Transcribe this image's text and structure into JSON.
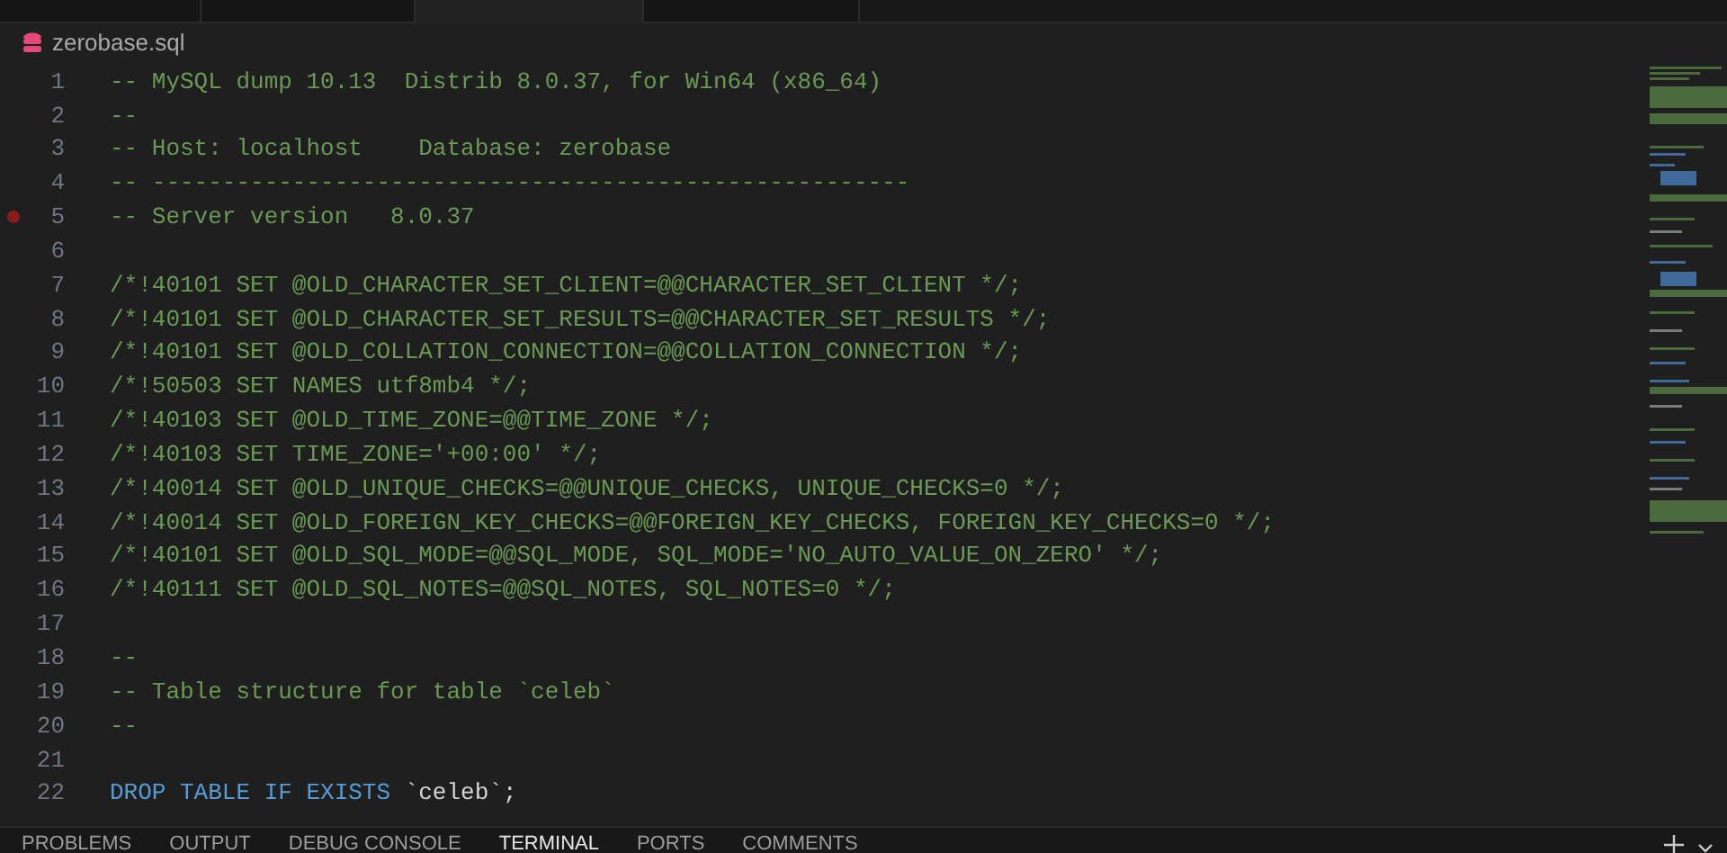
{
  "editor_tabs": [
    {
      "selected": false
    },
    {
      "selected": false
    },
    {
      "selected": true
    },
    {
      "selected": false
    }
  ],
  "breadcrumb": "zerobase.sql",
  "lines": [
    {
      "number": "1",
      "segments": [
        {
          "kind": "comment",
          "text": "-- MySQL dump 10.13  Distrib 8.0.37, for Win64 (x86_64)"
        }
      ]
    },
    {
      "number": "2",
      "segments": [
        {
          "kind": "comment",
          "text": "--"
        }
      ]
    },
    {
      "number": "3",
      "segments": [
        {
          "kind": "comment",
          "text": "-- Host: localhost    Database: zerobase"
        }
      ]
    },
    {
      "number": "4",
      "segments": [
        {
          "kind": "comment",
          "text": "-- ------------------------------------------------------"
        }
      ]
    },
    {
      "number": "5",
      "breakpoint": true,
      "segments": [
        {
          "kind": "comment",
          "text": "-- Server version\t8.0.37"
        }
      ]
    },
    {
      "number": "6"
    },
    {
      "number": "7",
      "segments": [
        {
          "kind": "comment",
          "text": "/*!40101 SET @OLD_CHARACTER_SET_CLIENT=@@CHARACTER_SET_CLIENT */;"
        }
      ]
    },
    {
      "number": "8",
      "segments": [
        {
          "kind": "comment",
          "text": "/*!40101 SET @OLD_CHARACTER_SET_RESULTS=@@CHARACTER_SET_RESULTS */;"
        }
      ]
    },
    {
      "number": "9",
      "segments": [
        {
          "kind": "comment",
          "text": "/*!40101 SET @OLD_COLLATION_CONNECTION=@@COLLATION_CONNECTION */;"
        }
      ]
    },
    {
      "number": "10",
      "segments": [
        {
          "kind": "comment",
          "text": "/*!50503 SET NAMES utf8mb4 */;"
        }
      ]
    },
    {
      "number": "11",
      "segments": [
        {
          "kind": "comment",
          "text": "/*!40103 SET @OLD_TIME_ZONE=@@TIME_ZONE */;"
        }
      ]
    },
    {
      "number": "12",
      "segments": [
        {
          "kind": "comment",
          "text": "/*!40103 SET TIME_ZONE='+00:00' */;"
        }
      ]
    },
    {
      "number": "13",
      "segments": [
        {
          "kind": "comment",
          "text": "/*!40014 SET @OLD_UNIQUE_CHECKS=@@UNIQUE_CHECKS, UNIQUE_CHECKS=0 */;"
        }
      ]
    },
    {
      "number": "14",
      "segments": [
        {
          "kind": "comment",
          "text": "/*!40014 SET @OLD_FOREIGN_KEY_CHECKS=@@FOREIGN_KEY_CHECKS, FOREIGN_KEY_CHECKS=0 */;"
        }
      ]
    },
    {
      "number": "15",
      "segments": [
        {
          "kind": "comment",
          "text": "/*!40101 SET @OLD_SQL_MODE=@@SQL_MODE, SQL_MODE='NO_AUTO_VALUE_ON_ZERO' */;"
        }
      ]
    },
    {
      "number": "16",
      "segments": [
        {
          "kind": "comment",
          "text": "/*!40111 SET @OLD_SQL_NOTES=@@SQL_NOTES, SQL_NOTES=0 */;"
        }
      ]
    },
    {
      "number": "17"
    },
    {
      "number": "18",
      "segments": [
        {
          "kind": "comment",
          "text": "--"
        }
      ]
    },
    {
      "number": "19",
      "segments": [
        {
          "kind": "comment",
          "text": "-- Table structure for table `celeb`"
        }
      ]
    },
    {
      "number": "20",
      "segments": [
        {
          "kind": "comment",
          "text": "--"
        }
      ]
    },
    {
      "number": "21"
    },
    {
      "number": "22",
      "segments": [
        {
          "kind": "keyword",
          "text": "DROP TABLE IF EXISTS"
        },
        {
          "kind": "plain",
          "text": " `celeb`;"
        }
      ]
    }
  ],
  "panel_tabs": [
    {
      "label": "PROBLEMS",
      "selected": false
    },
    {
      "label": "OUTPUT",
      "selected": false
    },
    {
      "label": "DEBUG CONSOLE",
      "selected": false
    },
    {
      "label": "TERMINAL",
      "selected": true
    },
    {
      "label": "PORTS",
      "selected": false
    },
    {
      "label": "COMMENTS",
      "selected": false
    }
  ]
}
